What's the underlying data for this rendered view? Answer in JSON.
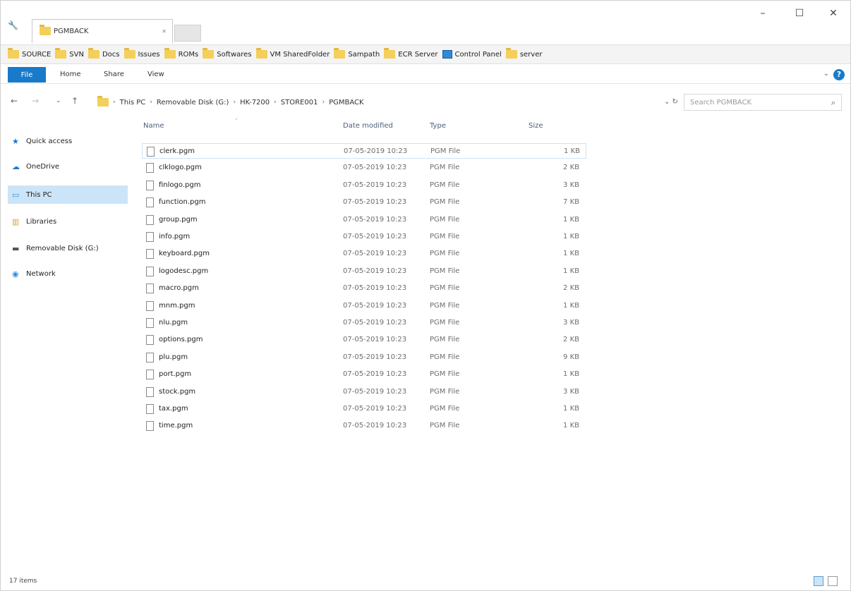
{
  "titlebar": {
    "tab_label": "PGMBACK",
    "minimize": "–",
    "maximize": "☐",
    "close": "✕"
  },
  "favorites": [
    {
      "label": "SOURCE",
      "icon": "folder-icon"
    },
    {
      "label": "SVN",
      "icon": "folder-icon"
    },
    {
      "label": "Docs",
      "icon": "folder-icon"
    },
    {
      "label": "Issues",
      "icon": "folder-icon"
    },
    {
      "label": "ROMs",
      "icon": "folder-icon"
    },
    {
      "label": "Softwares",
      "icon": "folder-icon"
    },
    {
      "label": "VM SharedFolder",
      "icon": "folder-icon"
    },
    {
      "label": "Sampath",
      "icon": "folder-icon"
    },
    {
      "label": "ECR Server",
      "icon": "folder-icon"
    },
    {
      "label": "Control Panel",
      "icon": "control-panel-icon"
    },
    {
      "label": "server",
      "icon": "folder-icon"
    }
  ],
  "ribbon": {
    "file": "File",
    "home": "Home",
    "share": "Share",
    "view": "View"
  },
  "address": {
    "crumbs": [
      "This PC",
      "Removable Disk (G:)",
      "HK-7200",
      "STORE001",
      "PGMBACK"
    ],
    "search_placeholder": "Search PGMBACK"
  },
  "nav": [
    {
      "label": "Quick access",
      "icon": "star-icon"
    },
    {
      "label": "OneDrive",
      "icon": "cloud-icon"
    },
    {
      "label": "This PC",
      "icon": "monitor-icon",
      "selected": true
    },
    {
      "label": "Libraries",
      "icon": "library-icon"
    },
    {
      "label": "Removable Disk (G:)",
      "icon": "drive-icon"
    },
    {
      "label": "Network",
      "icon": "network-icon"
    }
  ],
  "columns": {
    "name": "Name",
    "date": "Date modified",
    "type": "Type",
    "size": "Size"
  },
  "files": [
    {
      "name": "clerk.pgm",
      "date": "07-05-2019 10:23",
      "type": "PGM File",
      "size": "1 KB"
    },
    {
      "name": "clklogo.pgm",
      "date": "07-05-2019 10:23",
      "type": "PGM File",
      "size": "2 KB"
    },
    {
      "name": "finlogo.pgm",
      "date": "07-05-2019 10:23",
      "type": "PGM File",
      "size": "3 KB"
    },
    {
      "name": "function.pgm",
      "date": "07-05-2019 10:23",
      "type": "PGM File",
      "size": "7 KB"
    },
    {
      "name": "group.pgm",
      "date": "07-05-2019 10:23",
      "type": "PGM File",
      "size": "1 KB"
    },
    {
      "name": "info.pgm",
      "date": "07-05-2019 10:23",
      "type": "PGM File",
      "size": "1 KB"
    },
    {
      "name": "keyboard.pgm",
      "date": "07-05-2019 10:23",
      "type": "PGM File",
      "size": "1 KB"
    },
    {
      "name": "logodesc.pgm",
      "date": "07-05-2019 10:23",
      "type": "PGM File",
      "size": "1 KB"
    },
    {
      "name": "macro.pgm",
      "date": "07-05-2019 10:23",
      "type": "PGM File",
      "size": "2 KB"
    },
    {
      "name": "mnm.pgm",
      "date": "07-05-2019 10:23",
      "type": "PGM File",
      "size": "1 KB"
    },
    {
      "name": "nlu.pgm",
      "date": "07-05-2019 10:23",
      "type": "PGM File",
      "size": "3 KB"
    },
    {
      "name": "options.pgm",
      "date": "07-05-2019 10:23",
      "type": "PGM File",
      "size": "2 KB"
    },
    {
      "name": "plu.pgm",
      "date": "07-05-2019 10:23",
      "type": "PGM File",
      "size": "9 KB"
    },
    {
      "name": "port.pgm",
      "date": "07-05-2019 10:23",
      "type": "PGM File",
      "size": "1 KB"
    },
    {
      "name": "stock.pgm",
      "date": "07-05-2019 10:23",
      "type": "PGM File",
      "size": "3 KB"
    },
    {
      "name": "tax.pgm",
      "date": "07-05-2019 10:23",
      "type": "PGM File",
      "size": "1 KB"
    },
    {
      "name": "time.pgm",
      "date": "07-05-2019 10:23",
      "type": "PGM File",
      "size": "1 KB"
    }
  ],
  "status": {
    "items": "17 items"
  },
  "colors": {
    "accent": "#1979ca",
    "selection": "#cce4f7",
    "folder": "#f4cf5a"
  }
}
